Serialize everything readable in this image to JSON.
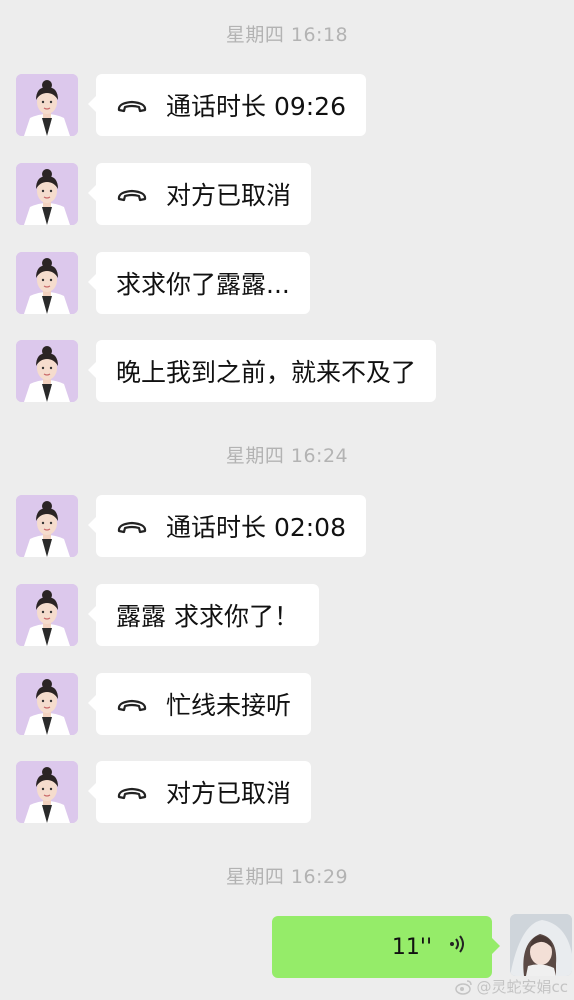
{
  "timestamps": [
    "星期四 16:18",
    "星期四 16:24",
    "星期四 16:29"
  ],
  "messages": [
    {
      "type": "call",
      "icon": "phone-hangup-icon",
      "text": "通话时长 09:26"
    },
    {
      "type": "call",
      "icon": "phone-hangup-icon",
      "text": "对方已取消"
    },
    {
      "type": "text",
      "text": "求求你了露露..."
    },
    {
      "type": "text",
      "text": "晚上我到之前，就来不及了"
    },
    {
      "type": "call",
      "icon": "phone-hangup-icon",
      "text": "通话时长 02:08"
    },
    {
      "type": "text",
      "text": "露露 求求你了！"
    },
    {
      "type": "call",
      "icon": "phone-hangup-icon",
      "text": "忙线未接听"
    },
    {
      "type": "call",
      "icon": "phone-hangup-icon",
      "text": "对方已取消"
    }
  ],
  "voice_message": {
    "duration": "11''",
    "icon": "voice-wave-icon"
  },
  "watermark": {
    "text": "@灵蛇安娟cc",
    "icon": "weibo-icon"
  },
  "colors": {
    "background": "#ededed",
    "incoming_bubble": "#ffffff",
    "outgoing_bubble": "#95ec69",
    "avatar_bg": "#d9c4ea",
    "timestamp": "#b3b3b3"
  }
}
